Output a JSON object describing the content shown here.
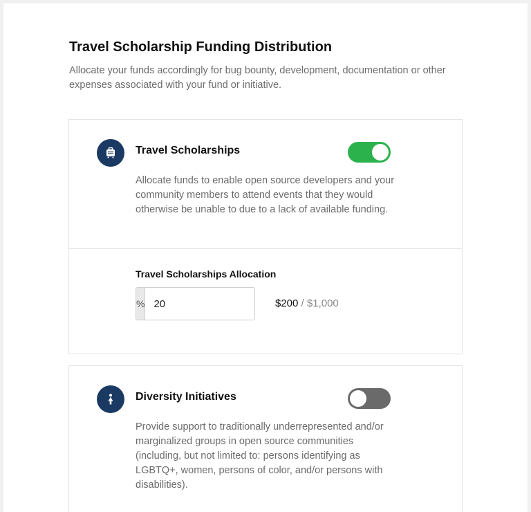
{
  "page": {
    "title": "Travel Scholarship Funding Distribution",
    "subtitle": "Allocate your funds accordingly for bug bounty, development, documentation or other expenses associated with your fund or initiative."
  },
  "cards": [
    {
      "icon": "suitcase-icon",
      "heading": "Travel Scholarships",
      "toggle_on": true,
      "description": "Allocate funds to enable open source developers and your community members to attend events that they would otherwise be unable to due to a lack of available funding.",
      "allocation": {
        "label": "Travel Scholarships Allocation",
        "prefix": "%",
        "value": "20",
        "amount": "$200",
        "separator": " / ",
        "total": "$1,000"
      }
    },
    {
      "icon": "person-icon",
      "heading": "Diversity Initiatives",
      "toggle_on": false,
      "description": "Provide support to traditionally underrepresented and/or marginalized groups in open source communities (including, but not limited to: persons identifying as LGBTQ+, women, persons of color, and/or persons with disabilities)."
    }
  ],
  "colors": {
    "icon_bg": "#1a3a63",
    "toggle_on": "#2bb24c",
    "toggle_off": "#6a6a6a"
  }
}
